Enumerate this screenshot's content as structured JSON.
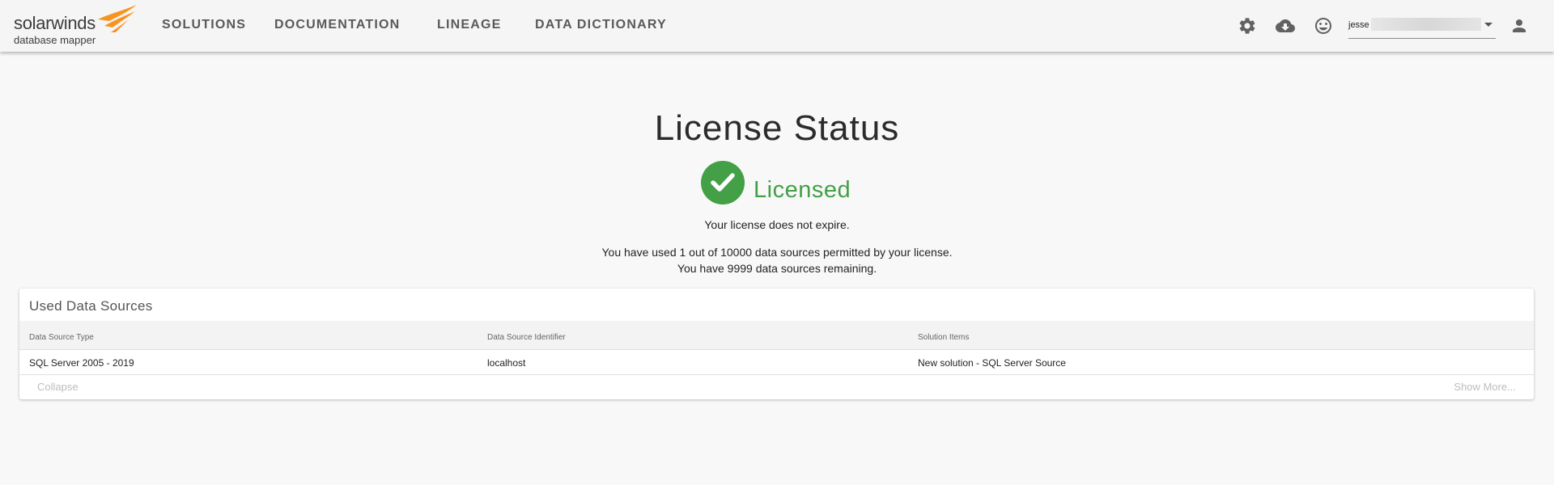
{
  "header": {
    "logo_brand": "solarwinds",
    "logo_sub": "database mapper",
    "nav": [
      "SOLUTIONS",
      "DOCUMENTATION",
      "LINEAGE",
      "DATA DICTIONARY"
    ],
    "icons": [
      "gear-icon",
      "cloud-download-icon",
      "smiley-icon",
      "account-icon"
    ],
    "user": "jesse"
  },
  "main": {
    "title": "License Status",
    "status": "Licensed",
    "status_color": "#43a047",
    "expiry_text": "Your license does not expire.",
    "usage_text": "You have used 1 out of 10000 data sources permitted by your license.",
    "remaining_text": "You have 9999 data sources remaining."
  },
  "used_sources": {
    "title": "Used Data Sources",
    "columns": [
      "Data Source Type",
      "Data Source Identifier",
      "Solution Items"
    ],
    "rows": [
      [
        "SQL Server 2005 - 2019",
        "localhost",
        "New solution - SQL Server Source"
      ]
    ],
    "collapse_label": "Collapse",
    "show_more_label": "Show More..."
  }
}
